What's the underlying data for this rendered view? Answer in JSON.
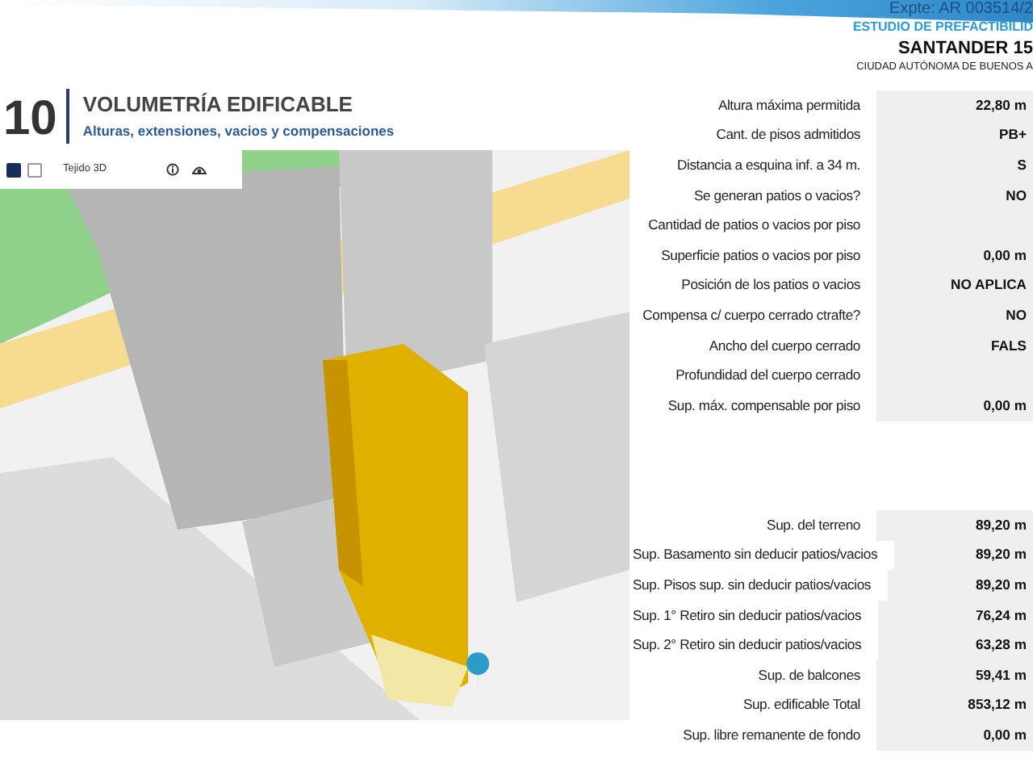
{
  "header": {
    "file_number": "Expte: AR 003514/2",
    "study": "ESTUDIO DE PREFACTIBILID",
    "address": "SANTANDER 15",
    "city": "CIUDAD AUTÓNOMA DE BUENOS A"
  },
  "section": {
    "number": "10",
    "title": "VOLUMETRÍA EDIFICABLE",
    "subtitle": "Alturas, extensiones, vacios y compensaciones"
  },
  "map": {
    "toggles": [
      {
        "checked": true
      },
      {
        "checked": false
      }
    ],
    "layer_label": "Tejido 3D"
  },
  "volume_table": [
    {
      "label": "Altura máxima permitida",
      "value": "22,80 m"
    },
    {
      "label": "Cant. de pisos admitidos",
      "value": "PB+"
    },
    {
      "label": "Distancia a esquina inf. a 34 m.",
      "value": "S"
    },
    {
      "label": "Se generan patios o vacios?",
      "value": "NO"
    },
    {
      "label": "Cantidad de patios o vacios por piso"
    },
    {
      "label": "Superficie patios o vacios por piso",
      "value": "0,00 m"
    },
    {
      "label": "Posición de los patios o vacios",
      "value": "NO APLICA"
    },
    {
      "label": "Compensa c/ cuerpo cerrado ctrafte?",
      "value": "NO"
    },
    {
      "label": "Ancho del  cuerpo cerrado",
      "value": "FALS"
    },
    {
      "label": "Profundidad del  cuerpo cerrado"
    },
    {
      "label": "Sup. máx. compensable por piso",
      "value": "0,00 m"
    }
  ],
  "area_table": [
    {
      "label": "Sup. del terreno",
      "value": "89,20 m"
    },
    {
      "label": "Sup. Basamento sin deducir patios/vacios",
      "value": "89,20 m"
    },
    {
      "label": "Sup. Pisos sup. sin deducir patios/vacios",
      "value": "89,20 m"
    },
    {
      "label": "Sup. 1° Retiro sin deducir patios/vacios",
      "value": "76,24 m"
    },
    {
      "label": "Sup. 2° Retiro sin deducir patios/vacios",
      "value": "63,28 m"
    },
    {
      "label": "Sup. de balcones",
      "value": "59,41 m"
    },
    {
      "label": "Sup. edificable Total",
      "value": "853,12 m"
    },
    {
      "label": "Sup. libre remanente de fondo",
      "value": "0,00 m"
    }
  ]
}
